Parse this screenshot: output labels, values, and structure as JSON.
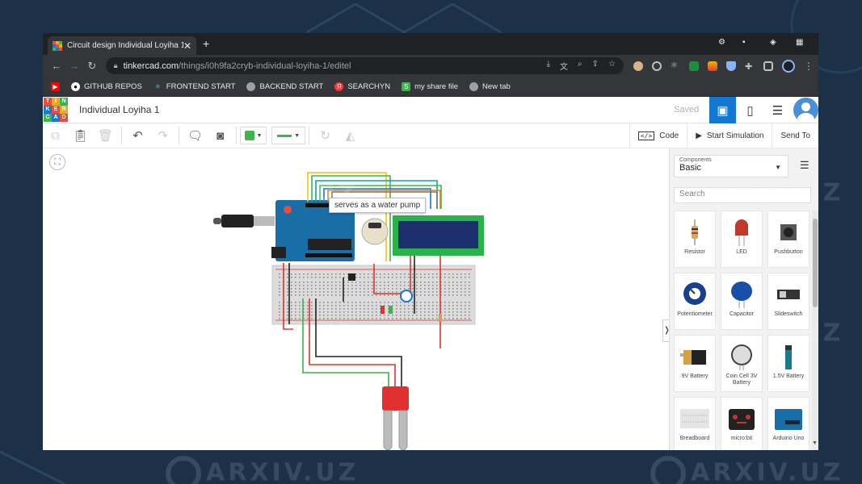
{
  "browser": {
    "tab_title": "Circuit design Individual Loyiha 1",
    "url_host": "tinkercad.com",
    "url_path": "/things/i0h9fa2cryb-individual-loyiha-1/editel",
    "bookmarks": [
      {
        "label": "GITHUB REPOS",
        "icon": "github-icon",
        "color": "#ffffff"
      },
      {
        "label": "FRONTEND START",
        "icon": "react-icon",
        "color": "#61dafb"
      },
      {
        "label": "BACKEND START",
        "icon": "globe-icon",
        "color": "#9aa0a6"
      },
      {
        "label": "SEARCHYN",
        "icon": "yandex-icon",
        "color": "#ff3333"
      },
      {
        "label": "my share file",
        "icon": "share-icon",
        "color": "#3db54a"
      },
      {
        "label": "New tab",
        "icon": "globe-icon",
        "color": "#9aa0a6"
      }
    ]
  },
  "app": {
    "logo_letters": [
      "T",
      "I",
      "N",
      "K",
      "E",
      "R",
      "C",
      "A",
      "D"
    ],
    "design_name": "Individual Loyiha 1",
    "save_status": "Saved",
    "toolbar": {
      "code_label": "Code",
      "start_simulation_label": "Start Simulation",
      "send_to_label": "Send To"
    },
    "tooltip": "serves as a water pump",
    "panel": {
      "category_heading": "Components",
      "category_value": "Basic",
      "search_placeholder": "Search",
      "components": [
        {
          "label": "Resistor",
          "icon": "resistor-icon"
        },
        {
          "label": "LED",
          "icon": "led-icon"
        },
        {
          "label": "Pushbutton",
          "icon": "pushbutton-icon"
        },
        {
          "label": "Potentiometer",
          "icon": "potentiometer-icon"
        },
        {
          "label": "Capacitor",
          "icon": "capacitor-icon"
        },
        {
          "label": "Slideswitch",
          "icon": "slideswitch-icon"
        },
        {
          "label": "9V Battery",
          "icon": "battery-9v-icon"
        },
        {
          "label": "Coin Cell 3V Battery",
          "icon": "coin-cell-icon"
        },
        {
          "label": "1.5V Battery",
          "icon": "battery-aa-icon"
        },
        {
          "label": "Breadboard",
          "icon": "breadboard-icon"
        },
        {
          "label": "micro:bit",
          "icon": "microbit-icon"
        },
        {
          "label": "Arduino Uno",
          "icon": "arduino-icon"
        }
      ]
    }
  },
  "watermark": "ARXIV.UZ",
  "colors": {
    "page_bg": "#1c3048",
    "tinkercad_blue": "#1477d1",
    "accent_green": "#3db54a"
  }
}
